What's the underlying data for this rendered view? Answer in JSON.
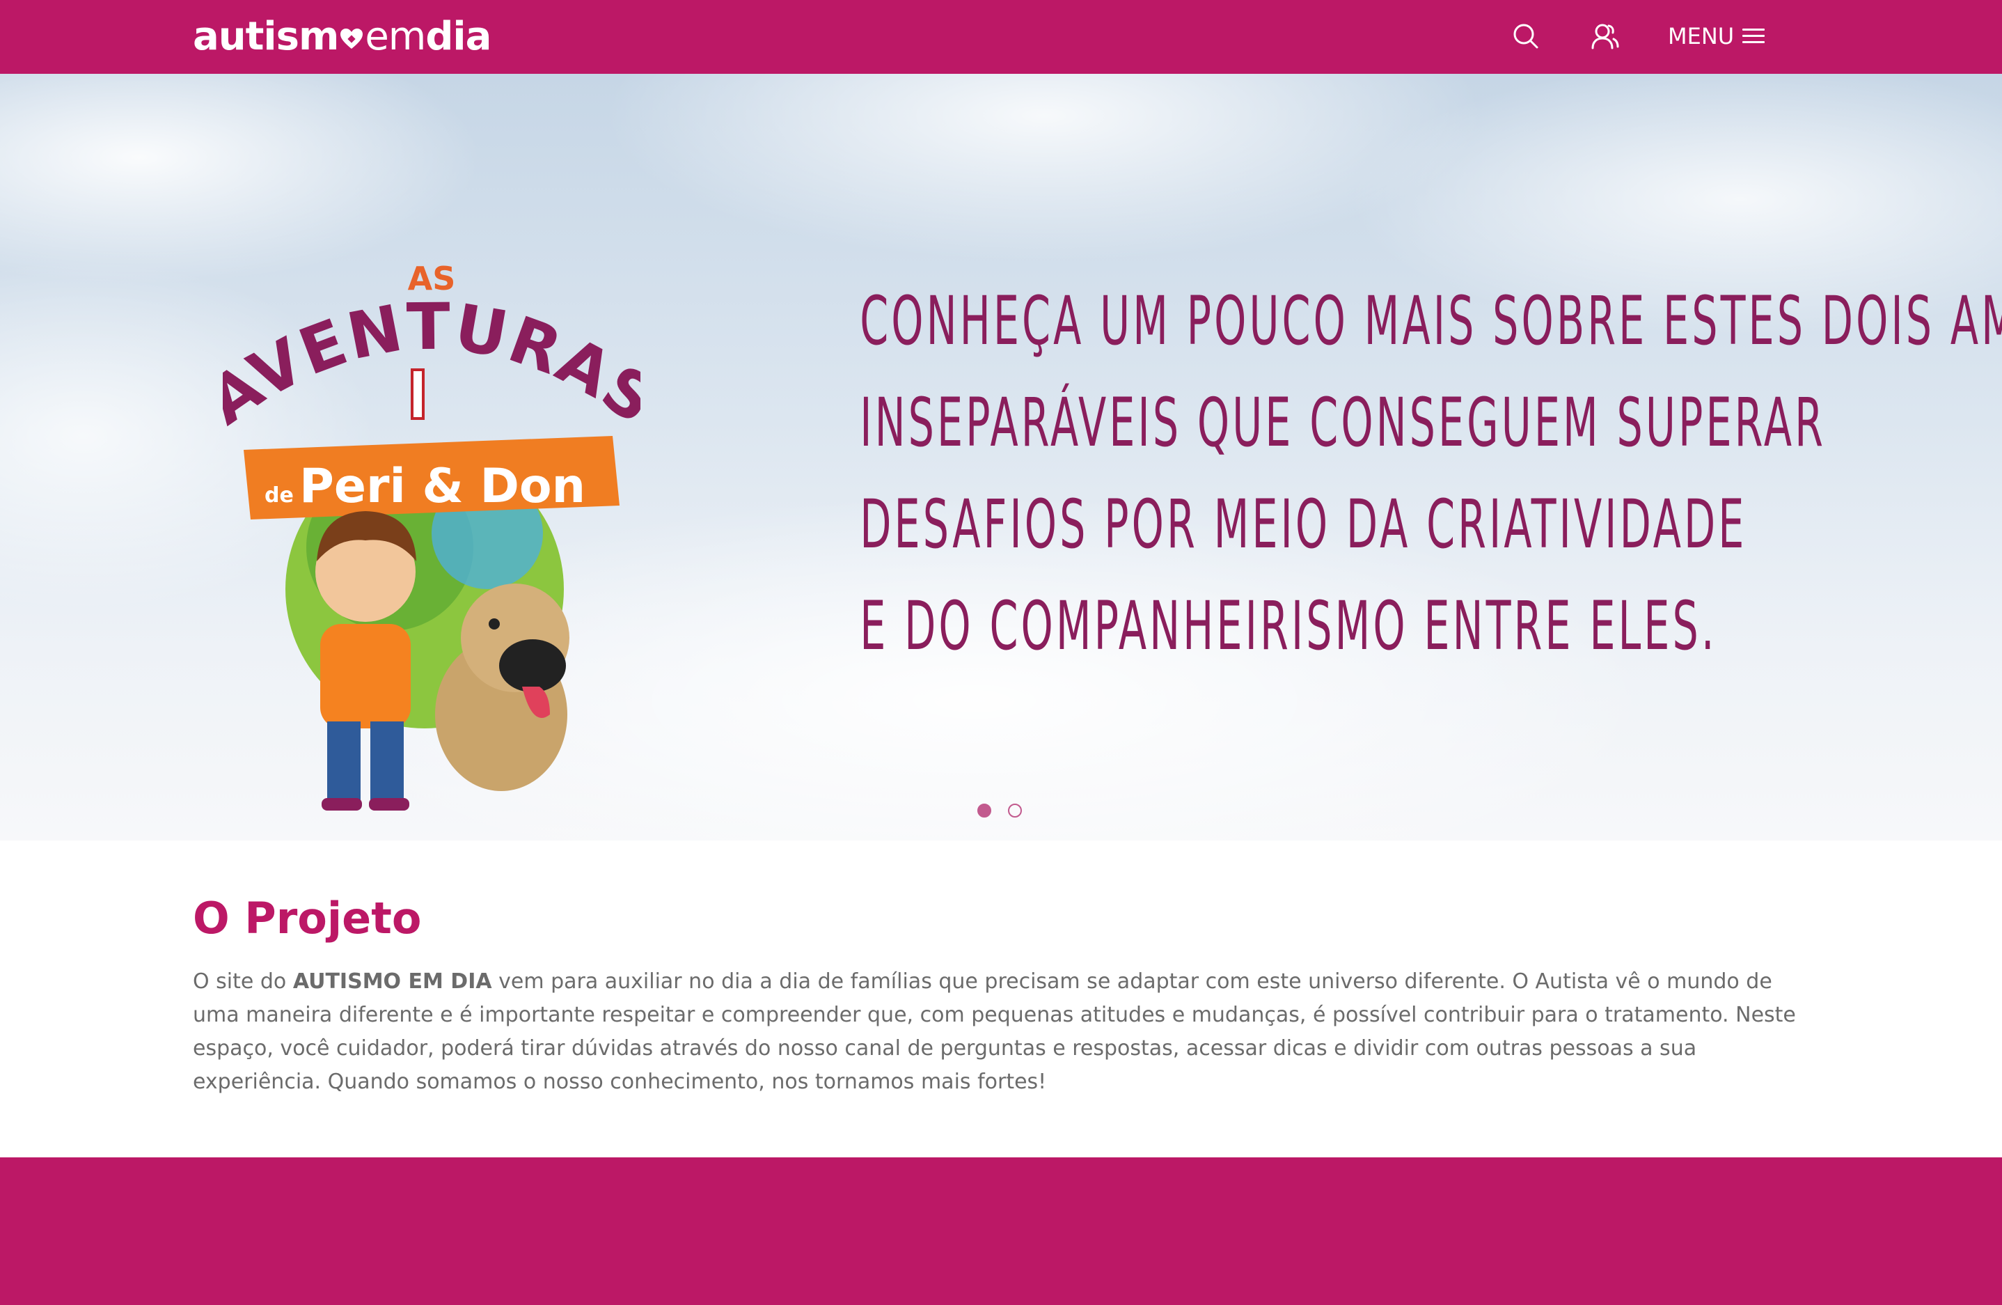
{
  "header": {
    "logo": {
      "part1": "autism",
      "part2": "em",
      "part3": "dia"
    },
    "search_icon": "search-icon",
    "user_icon": "user-icon",
    "menu_label": "MENU",
    "menu_icon": "hamburger-icon"
  },
  "colors": {
    "brand": "#bc1866",
    "hero_text": "#8a1e5c",
    "body_text": "#6b6b6b",
    "dot": "#c25a8e"
  },
  "hero": {
    "art_title": {
      "line1": "AS",
      "line2": "AVENTURAS",
      "line3_prefix": "de",
      "line3": "Peri & Don"
    },
    "lines": [
      "CONHEÇA UM POUCO MAIS SOBRE ESTES DOIS AMIGOS",
      "INSEPARÁVEIS QUE CONSEGUEM SUPERAR",
      "DESAFIOS POR MEIO DA CRIATIVIDADE",
      "E DO COMPANHEIRISMO ENTRE ELES."
    ],
    "slides": {
      "total": 2,
      "active": 1
    }
  },
  "project": {
    "title": "O Projeto",
    "text_before": "O site do ",
    "text_bold": "AUTISMO EM DIA",
    "text_after": " vem para auxiliar no dia a dia de famílias que precisam se adaptar com este universo diferente. O Autista vê o mundo de uma maneira diferente e é importante respeitar e compreender que, com pequenas atitudes e mudanças, é possível contribuir para o tratamento. Neste espaço, você cuidador, poderá tirar dúvidas através do nosso canal de perguntas e respostas, acessar dicas e dividir com outras pessoas a sua experiência. Quando somamos o nosso conhecimento, nos tornamos mais fortes!"
  }
}
